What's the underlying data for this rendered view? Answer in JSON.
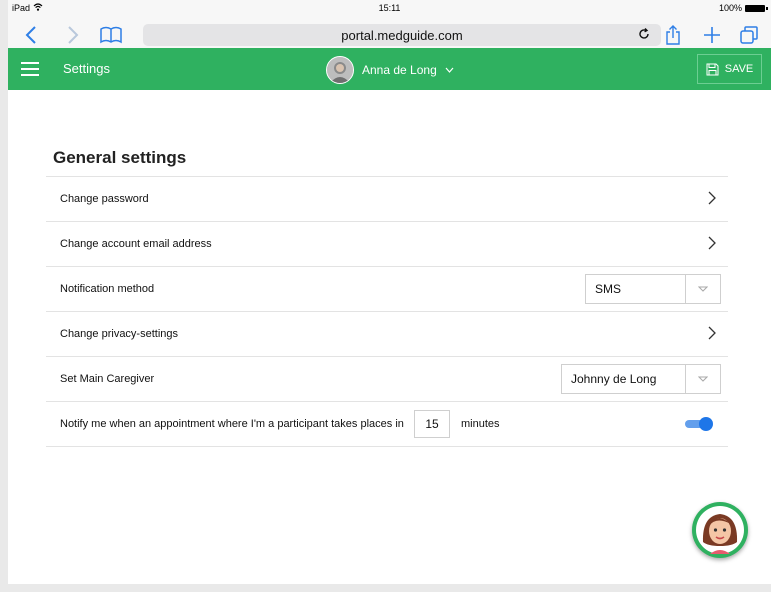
{
  "status_bar": {
    "device": "iPad",
    "time": "15:11",
    "battery": "100%"
  },
  "browser": {
    "url": "portal.medguide.com"
  },
  "header": {
    "title": "Settings",
    "user_name": "Anna de Long",
    "save_label": "SAVE"
  },
  "settings": {
    "section_title": "General settings",
    "change_password": "Change password",
    "change_email": "Change account email address",
    "notification_method": {
      "label": "Notification method",
      "value": "SMS"
    },
    "change_privacy": "Change privacy-settings",
    "main_caregiver": {
      "label": "Set Main Caregiver",
      "value": "Johnny de Long"
    },
    "notify": {
      "label": "Notify me when an appointment where I'm a participant takes places in",
      "minutes_value": "15",
      "minutes_unit": "minutes",
      "enabled": true
    }
  },
  "colors": {
    "brand_green": "#2fb160",
    "toggle_blue": "#1e76e8",
    "ios_blue": "#2f7fe6"
  }
}
